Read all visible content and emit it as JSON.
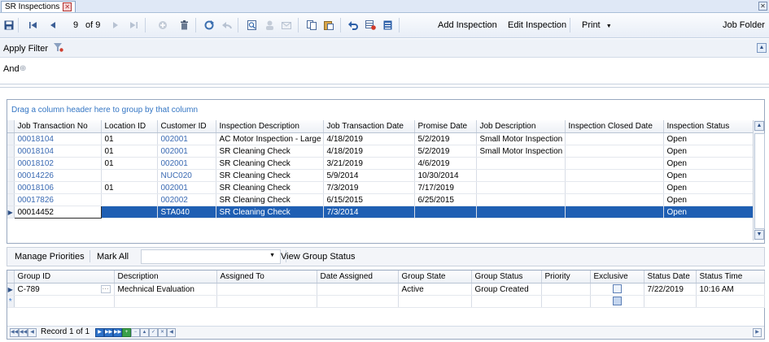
{
  "tab": {
    "title": "SR Inspections"
  },
  "toolbar": {
    "record_position": "9",
    "record_total": "of 9",
    "add_inspection": "Add Inspection",
    "edit_inspection": "Edit Inspection",
    "print": "Print",
    "job_folder": "Job Folder"
  },
  "filter": {
    "apply_filter": "Apply Filter",
    "and": "And"
  },
  "grid1": {
    "group_hint": "Drag a column header here to group by that column",
    "columns": [
      "Job Transaction No",
      "Location ID",
      "Customer ID",
      "Inspection Description",
      "Job Transaction Date",
      "Promise Date",
      "Job Description",
      "Inspection Closed Date",
      "Inspection Status"
    ],
    "rows": [
      [
        "00018104",
        "01",
        "002001",
        "AC Motor Inspection - Large",
        "4/18/2019",
        "5/2/2019",
        "Small Motor Inspection",
        "",
        "Open"
      ],
      [
        "00018104",
        "01",
        "002001",
        "SR Cleaning Check",
        "4/18/2019",
        "5/2/2019",
        "Small Motor Inspection",
        "",
        "Open"
      ],
      [
        "00018102",
        "01",
        "002001",
        "SR Cleaning Check",
        "3/21/2019",
        "4/6/2019",
        "",
        "",
        "Open"
      ],
      [
        "00014226",
        "",
        "NUC020",
        "SR Cleaning Check",
        "5/9/2014",
        "10/30/2014",
        "",
        "",
        "Open"
      ],
      [
        "00018106",
        "01",
        "002001",
        "SR Cleaning Check",
        "7/3/2019",
        "7/17/2019",
        "",
        "",
        "Open"
      ],
      [
        "00017826",
        "",
        "002002",
        "SR Cleaning Check",
        "6/15/2015",
        "6/25/2015",
        "",
        "",
        "Open"
      ],
      [
        "00014452",
        "",
        "STA040",
        "SR Cleaning Check",
        "7/3/2014",
        "",
        "",
        "",
        "Open"
      ]
    ],
    "selected_row": 6
  },
  "groupbar": {
    "manage_priorities": "Manage Priorities",
    "mark_all": "Mark All",
    "view_group_status": "View Group Status"
  },
  "grid2": {
    "columns": [
      "Group ID",
      "Description",
      "Assigned To",
      "Date Assigned",
      "Group State",
      "Group Status",
      "Priority",
      "Exclusive",
      "Status Date",
      "Status Time"
    ],
    "rows": [
      {
        "group_id": "C-789",
        "description": "Mechnical Evaluation",
        "assigned_to": "",
        "date_assigned": "",
        "group_state": "Active",
        "group_status": "Group Created",
        "priority": "",
        "status_date": "7/22/2019",
        "status_time": "10:16 AM"
      }
    ],
    "navigator": "Record 1 of 1"
  },
  "colors": {
    "accent": "#1f5fb3",
    "link": "#3a6ab3"
  }
}
